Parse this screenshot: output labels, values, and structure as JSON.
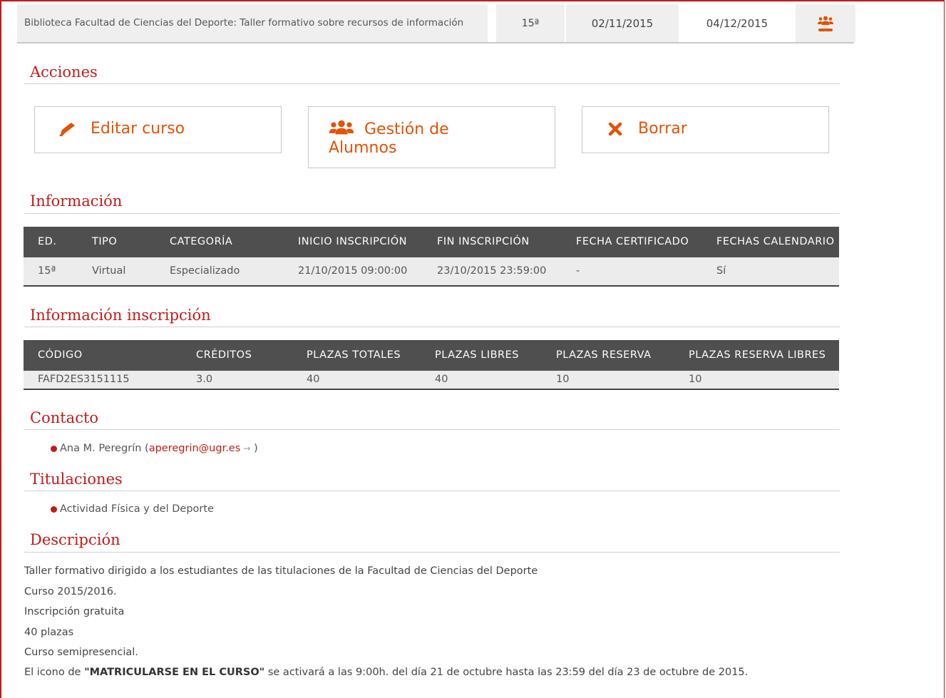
{
  "course_row": {
    "title": "Biblioteca Facultad de Ciencias del Deporte: Taller formativo sobre recursos de información",
    "edition": "15ª",
    "start_date": "02/11/2015",
    "end_date": "04/12/2015",
    "students_icon": "users-icon"
  },
  "acciones": {
    "heading": "Acciones",
    "edit_label": "Editar curso",
    "students_label": "Gestión de Alumnos",
    "delete_label": "Borrar",
    "edit_icon": "pencil-icon",
    "students_icon": "users-icon",
    "delete_icon": "close-icon"
  },
  "informacion": {
    "heading": "Información",
    "headers": [
      "ED.",
      "TIPO",
      "CATEGORÍA",
      "INICIO INSCRIPCIÓN",
      "FIN INSCRIPCIÓN",
      "FECHA CERTIFICADO",
      "FECHAS CALENDARIO"
    ],
    "row": [
      "15ª",
      "Virtual",
      "Especializado",
      "21/10/2015 09:00:00",
      "23/10/2015 23:59:00",
      "-",
      "Sí"
    ]
  },
  "inscripcion": {
    "heading": "Información inscripción",
    "headers": [
      "CÓDIGO",
      "CRÉDITOS",
      "PLAZAS TOTALES",
      "PLAZAS LIBRES",
      "PLAZAS RESERVA",
      "PLAZAS RESERVA LIBRES"
    ],
    "row": [
      "FAFD2ES3151115",
      "3.0",
      "40",
      "40",
      "10",
      "10"
    ]
  },
  "contacto": {
    "heading": "Contacto",
    "name": "Ana M. Peregrín",
    "email": "aperegrin@ugr.es",
    "arrow": "→"
  },
  "titulaciones": {
    "heading": "Titulaciones",
    "items": [
      "Actividad Física y del Deporte"
    ]
  },
  "descripcion": {
    "heading": "Descripción",
    "lines": [
      "Taller formativo dirigido a los estudiantes de las titulaciones de la Facultad de Ciencias del Deporte",
      "Curso 2015/2016.",
      "Inscripción gratuita",
      "40 plazas",
      "Curso semipresencial."
    ],
    "last_prefix": "El icono de ",
    "last_bold": "\"MATRICULARSE EN EL CURSO\"",
    "last_suffix": " se activará a las 9:00h. del día 21 de octubre hasta las 23:59 del día 23 de octubre de 2015."
  },
  "colors": {
    "accent": "#c21b17",
    "orange": "#e35205",
    "header_bg": "#4f4f4f"
  }
}
